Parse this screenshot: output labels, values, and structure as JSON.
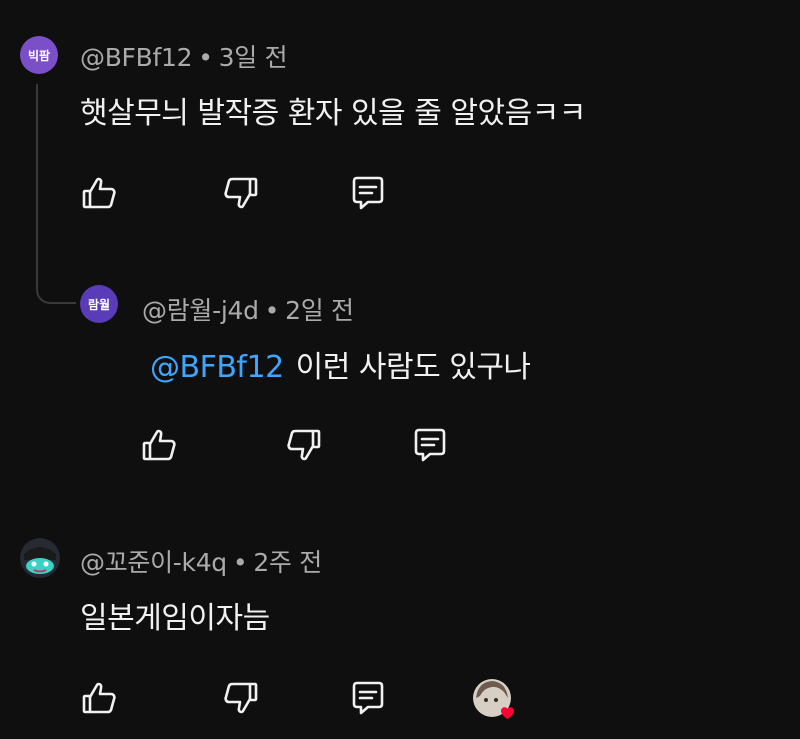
{
  "comments": [
    {
      "avatar_text": "빅팜",
      "avatar_color": "#7b4fc8",
      "handle": "@BFBf12",
      "time": "3일 전",
      "text": "햇살무늬 발작증 환자 있을 줄 알았음ㅋㅋ"
    },
    {
      "avatar_text": "람월",
      "avatar_color": "#5a3bb8",
      "handle": "@람월-j4d",
      "time": "2일 전",
      "mention": "@BFBf12",
      "text": "이런 사람도 있구나"
    },
    {
      "avatar_text": "",
      "handle": "@꼬준이-k4q",
      "time": "2주 전",
      "text": "일본게임이자늠"
    }
  ],
  "separator": "•",
  "icons": {
    "like": "thumbs-up-icon",
    "dislike": "thumbs-down-icon",
    "reply": "reply-comment-icon",
    "creator_heart": "creator-heart-icon"
  },
  "colors": {
    "background": "#0f0f0f",
    "text": "#f1f1f1",
    "meta": "#aaaaaa",
    "mention": "#3ea6ff",
    "heart": "#ff0033"
  }
}
